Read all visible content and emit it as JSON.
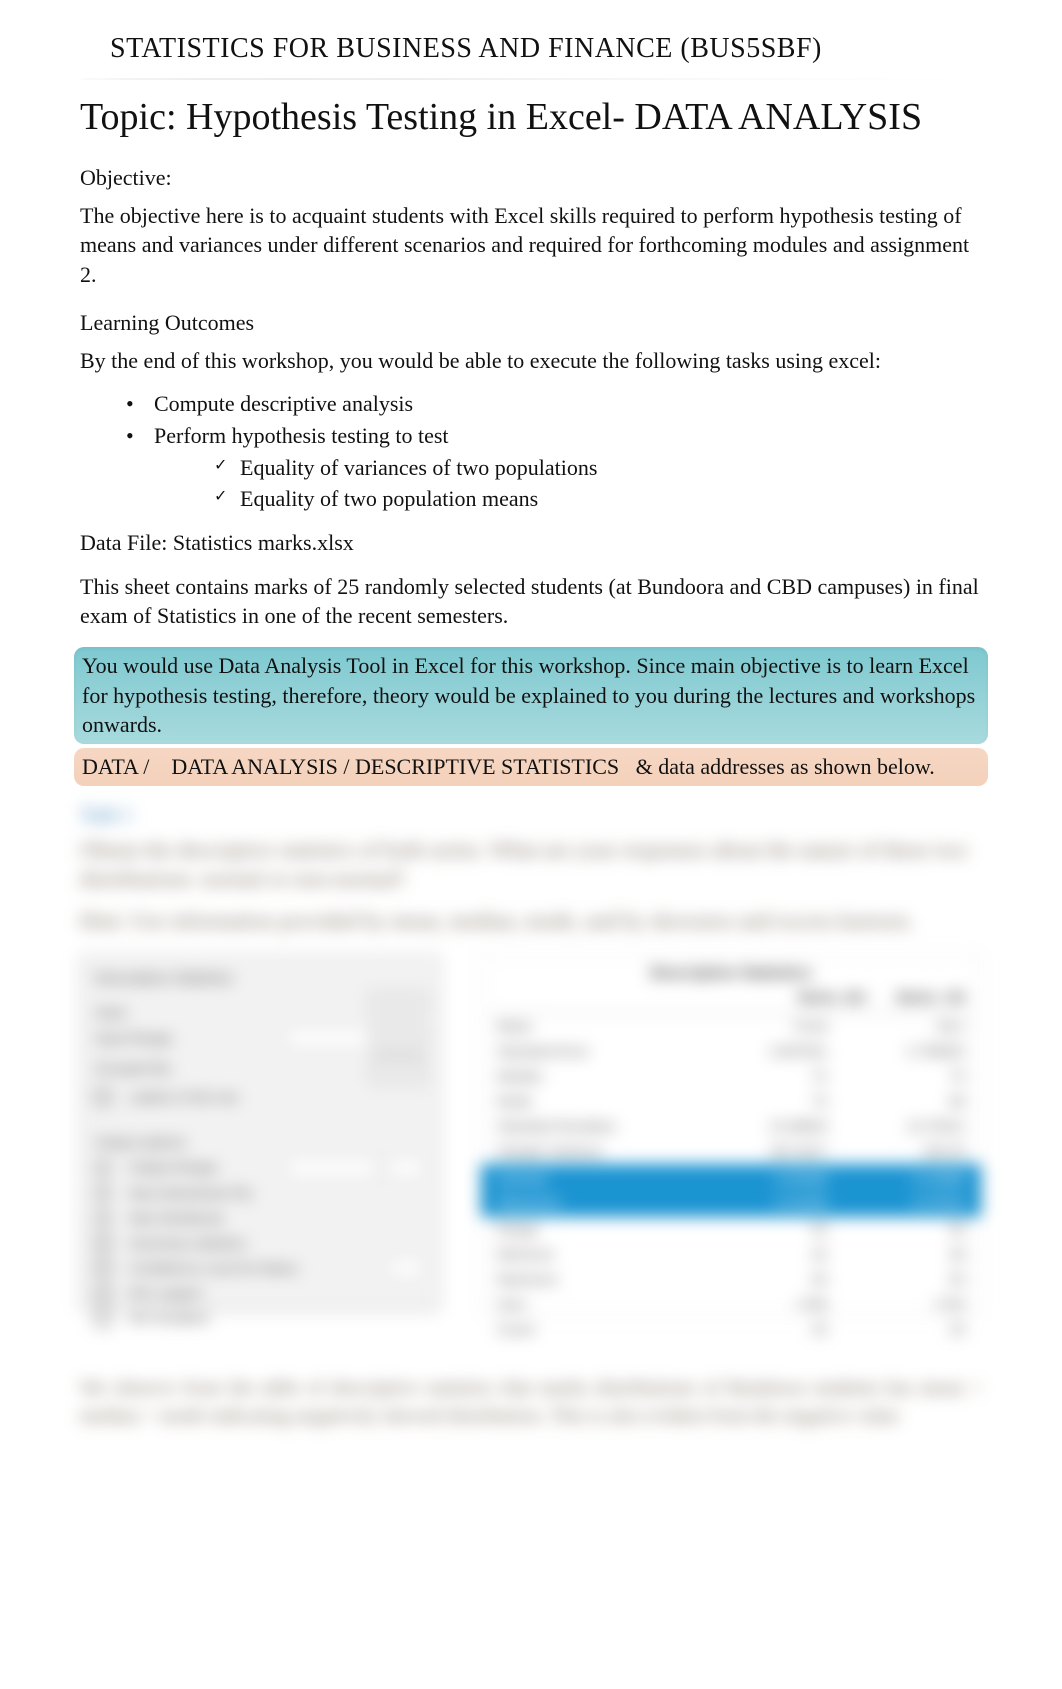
{
  "course_header": "STATISTICS FOR BUSINESS AND FINANCE (BUS5SBF)",
  "topic_title": "Topic: Hypothesis Testing in Excel- DATA ANALYSIS",
  "objective_heading": "Objective:",
  "objective_text": "The objective here is to acquaint students with Excel skills required to perform hypothesis testing of means and variances under different scenarios and required for forthcoming modules and assignment 2.",
  "outcomes_heading": "Learning Outcomes",
  "outcomes_intro": "By the end of this workshop, you would be able to execute the following tasks using excel:",
  "outcomes_bullets": {
    "b0": "Compute descriptive analysis",
    "b1": "Perform hypothesis testing to test",
    "sub0": "Equality of variances of two populations",
    "sub1": "Equality of two population means"
  },
  "data_file_label": "Data File: Statistics marks.xlsx",
  "data_file_desc": "This sheet contains marks of 25 randomly selected students (at Bundoora and CBD campuses) in final exam of Statistics in one of the recent semesters.",
  "blue_callout": "You would use Data Analysis Tool in Excel for this workshop. Since main objective is to learn Excel for hypothesis testing, therefore, theory would be explained to you during the lectures and workshops onwards.",
  "orange_segments": {
    "s0": "DATA",
    "sep0": "/",
    "s1": "DATA ANALYSIS",
    "sep1": "/",
    "s2": "DESCRIPTIVE STATISTICS",
    "tail": "& data addresses as shown below."
  },
  "blurred": {
    "task_label": "Task 1",
    "q1": "Obtain the descriptive statistics of both series. What are your responses about the nature of these two distributions: normal or non-normal?",
    "hint": "Hint: Use information provided by mean, median, mode, and by skewness and excess kurtosis.",
    "dialog": {
      "title": "Descriptive Statistics",
      "input_label": "Input",
      "input_range": "Input Range:",
      "grouped_by": "Grouped By:",
      "grouped_value": "Columns",
      "labels_first_row": "Labels in first row",
      "output_section": "Output options",
      "output_range": "Output Range:",
      "new_ws": "New Worksheet Ply:",
      "new_wb": "New Workbook",
      "summary_stats": "Summary statistics",
      "conf_level": "Confidence Level for Mean:",
      "kth_largest": "Kth Largest:",
      "kth_smallest": "Kth Smallest:",
      "btn_ok": "OK",
      "btn_cancel": "Cancel",
      "btn_help": "Help"
    },
    "results": {
      "title": "Descriptive Statistics",
      "col1": "Marks_BU",
      "col2": "Marks_CB",
      "rows": {
        "mean": {
          "n": "Mean",
          "a": "70.64",
          "b": "69.2"
        },
        "se": {
          "n": "Standard Error",
          "a": "2.697641",
          "b": "2.758625"
        },
        "median": {
          "n": "Median",
          "a": "72",
          "b": "70"
        },
        "mode": {
          "n": "Mode",
          "a": "74",
          "b": "68"
        },
        "stdev": {
          "n": "Standard Deviation",
          "a": "13.48820",
          "b": "13.79312"
        },
        "var": {
          "n": "Sample Variance",
          "a": "181.9317",
          "b": "190.25"
        },
        "kurt": {
          "n": "Kurtosis",
          "a": "-0.45283",
          "b": "-0.23698"
        },
        "skew": {
          "n": "Skewness",
          "a": "-0.31626",
          "b": "-0.47815"
        },
        "range": {
          "n": "Range",
          "a": "52",
          "b": "55"
        },
        "min": {
          "n": "Minimum",
          "a": "42",
          "b": "38"
        },
        "max": {
          "n": "Maximum",
          "a": "94",
          "b": "93"
        },
        "sum": {
          "n": "Sum",
          "a": "1766",
          "b": "1730"
        },
        "count": {
          "n": "Count",
          "a": "25",
          "b": "25"
        }
      }
    }
  },
  "footer_blurred": "We observe from the table of descriptive statistics that marks distributions of Bundoora students has mean > median > mode indicating negatively skewed distribution. This is also evident from the negative value"
}
